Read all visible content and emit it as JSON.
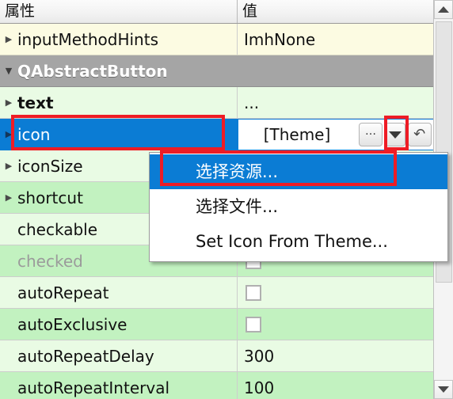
{
  "header": {
    "property_column": "属性",
    "value_column": "值"
  },
  "rows": [
    {
      "name": "inputMethodHints",
      "value": "ImhNone",
      "twisty": "▶",
      "style": "yellow",
      "bold": false,
      "disabled": false,
      "value_type": "text"
    },
    {
      "name": "QAbstractButton",
      "value": "",
      "twisty": "▼",
      "style": "group",
      "bold": true,
      "disabled": false,
      "value_type": "none"
    },
    {
      "name": "text",
      "value": "...",
      "twisty": "▶",
      "style": "rA",
      "bold": true,
      "disabled": false,
      "value_type": "text"
    },
    {
      "name": "icon",
      "value": "[Theme]",
      "twisty": "▶",
      "style": "sel",
      "bold": false,
      "disabled": false,
      "value_type": "editor"
    },
    {
      "name": "iconSize",
      "value": "",
      "twisty": "▶",
      "style": "rA",
      "bold": false,
      "disabled": false,
      "value_type": "text"
    },
    {
      "name": "shortcut",
      "value": "",
      "twisty": "▶",
      "style": "rB",
      "bold": false,
      "disabled": false,
      "value_type": "text"
    },
    {
      "name": "checkable",
      "value": "",
      "twisty": "",
      "style": "rA",
      "bold": false,
      "disabled": false,
      "value_type": "checkbox"
    },
    {
      "name": "checked",
      "value": "",
      "twisty": "",
      "style": "rB",
      "bold": false,
      "disabled": true,
      "value_type": "checkbox"
    },
    {
      "name": "autoRepeat",
      "value": "",
      "twisty": "",
      "style": "rA",
      "bold": false,
      "disabled": false,
      "value_type": "checkbox"
    },
    {
      "name": "autoExclusive",
      "value": "",
      "twisty": "",
      "style": "rB",
      "bold": false,
      "disabled": false,
      "value_type": "checkbox"
    },
    {
      "name": "autoRepeatDelay",
      "value": "300",
      "twisty": "",
      "style": "rA",
      "bold": false,
      "disabled": false,
      "value_type": "text"
    },
    {
      "name": "autoRepeatInterval",
      "value": "100",
      "twisty": "",
      "style": "rB",
      "bold": false,
      "disabled": false,
      "value_type": "text"
    }
  ],
  "icon_editor": {
    "value": "[Theme]",
    "ellipsis_label": "…",
    "dropdown_icon": "chevron-down-icon",
    "reset_icon": "reset-arrow-icon"
  },
  "context_menu": {
    "items": [
      {
        "label": "选择资源...",
        "active": true
      },
      {
        "label": "选择文件...",
        "active": false
      },
      {
        "label": "Set Icon From Theme...",
        "active": false
      }
    ]
  },
  "scrollbar": {
    "up_icon": "triangle-up-icon",
    "down_icon": "triangle-down-icon"
  },
  "annotations": {
    "accent_color": "#ee1c25",
    "selection_color": "#0b7cd4",
    "boxes": [
      "icon-row",
      "dropdown-button",
      "select-resource-menu-item"
    ]
  }
}
